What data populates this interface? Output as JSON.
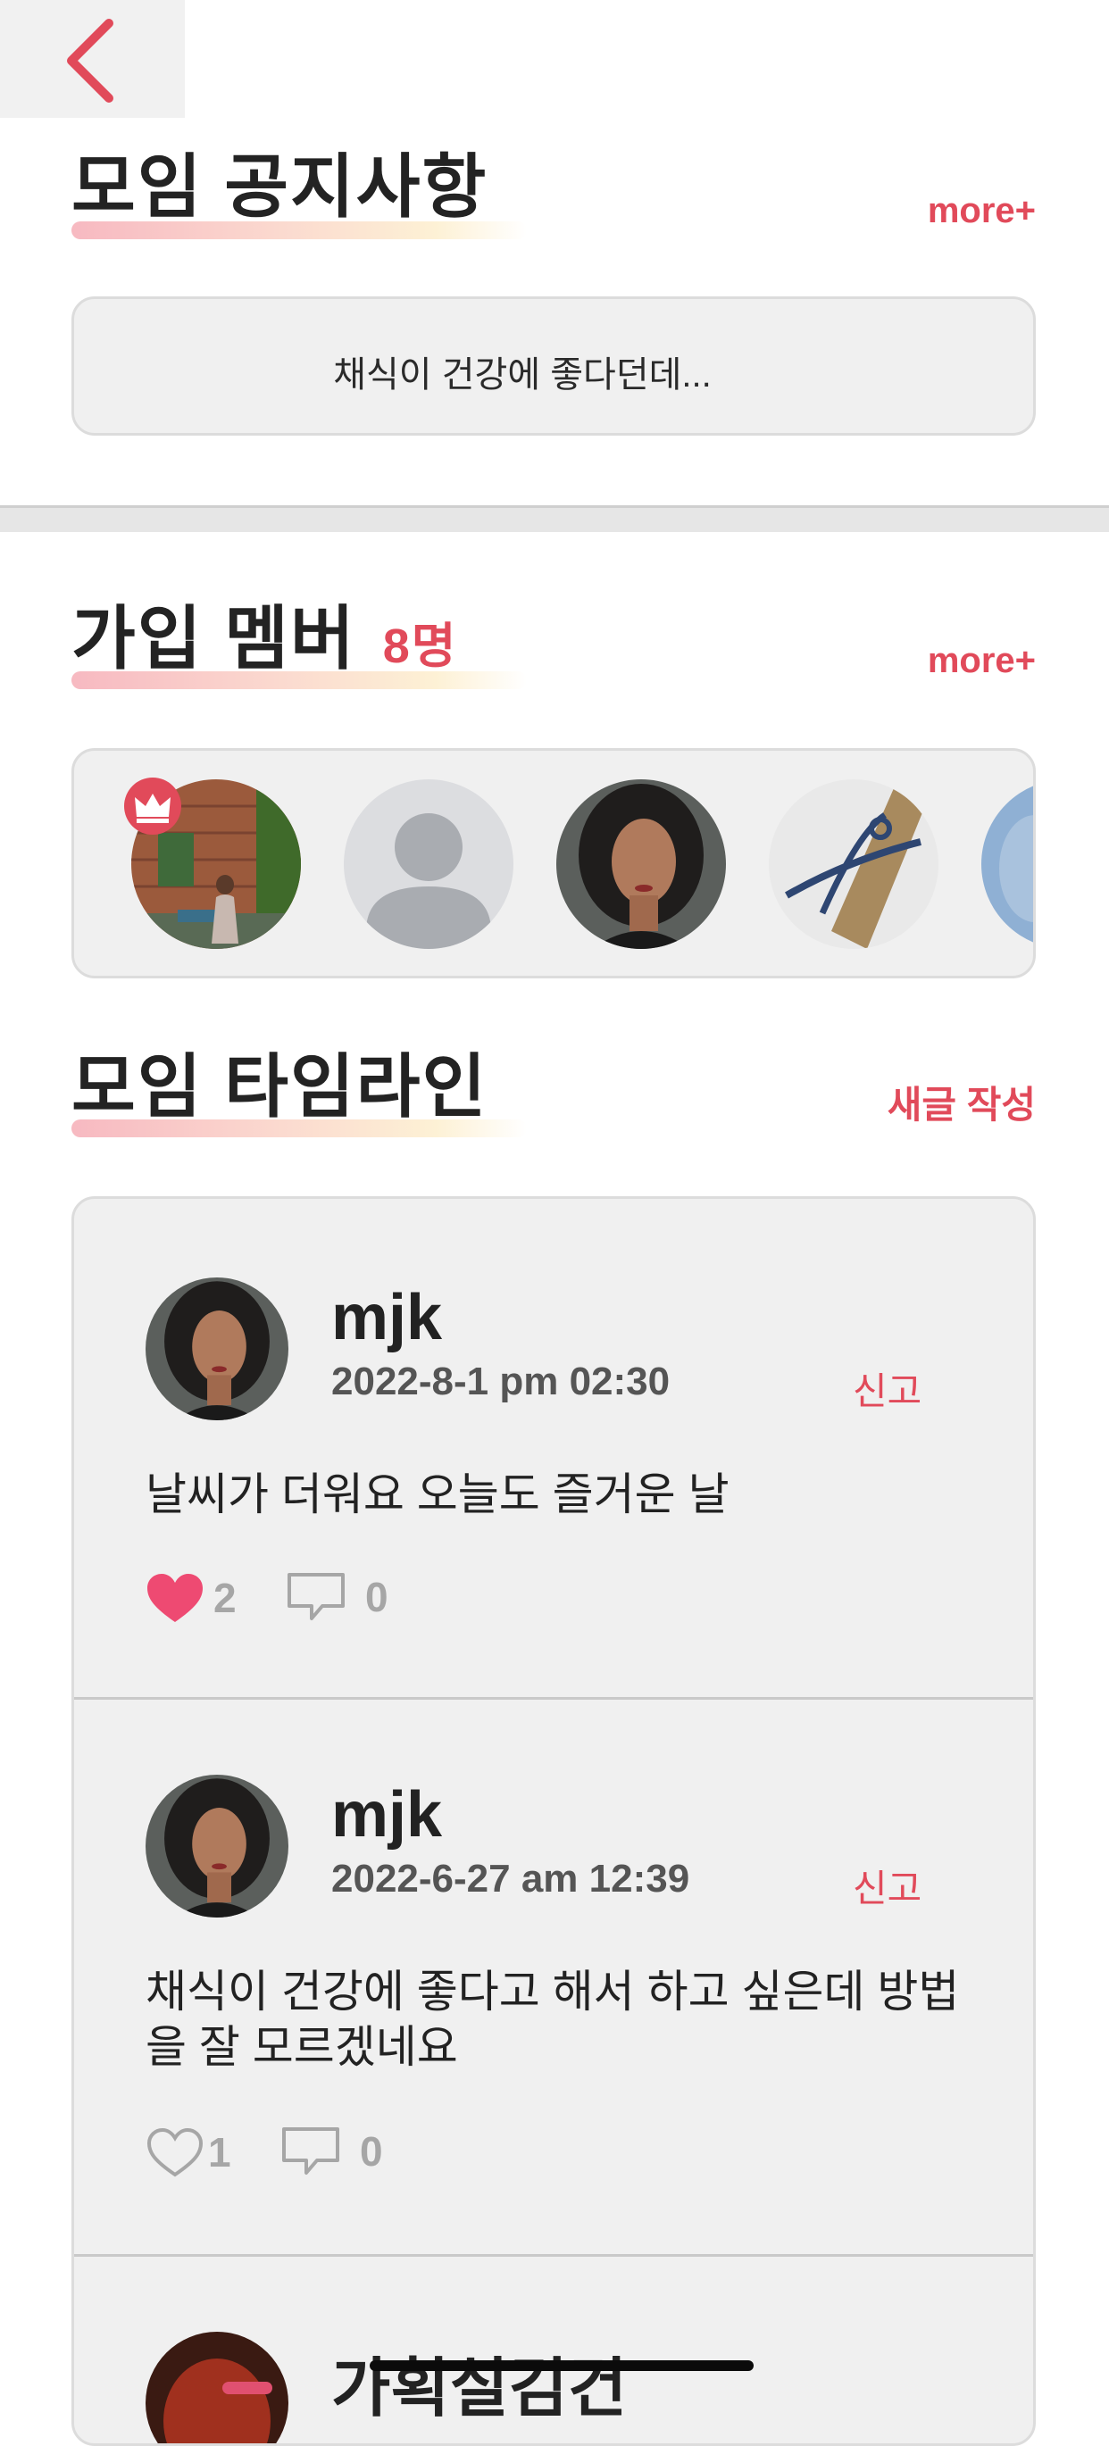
{
  "notice": {
    "title": "모임 공지사항",
    "more_label": "more+",
    "preview": "채식이 건강에 좋다던데..."
  },
  "members": {
    "title": "가입 멤버",
    "count": "8명",
    "more_label": "more+",
    "avatars": [
      "leader-photo",
      "default-person",
      "woman-portrait",
      "wrapped-gift",
      "partial-photo"
    ]
  },
  "timeline": {
    "title": "모임 타임라인",
    "write_label": "새글 작성",
    "posts": [
      {
        "author": "mjk",
        "date": "2022-8-1 pm 02:30",
        "report_label": "신고",
        "content": "날씨가 더워요 오늘도 즐거운 날",
        "likes": "2",
        "liked": true,
        "comments": "0"
      },
      {
        "author": "mjk",
        "date": "2022-6-27 am 12:39",
        "report_label": "신고",
        "content": "채식이 건강에 좋다고 해서 하고 싶은데 방법을 잘 모르겠네요",
        "likes": "1",
        "liked": false,
        "comments": "0"
      },
      {
        "author": "가획실김건"
      }
    ]
  },
  "colors": {
    "accent": "#e14a5a",
    "like": "#ee4a72",
    "panel": "#f0f0f0",
    "border": "#dcdcdc"
  }
}
